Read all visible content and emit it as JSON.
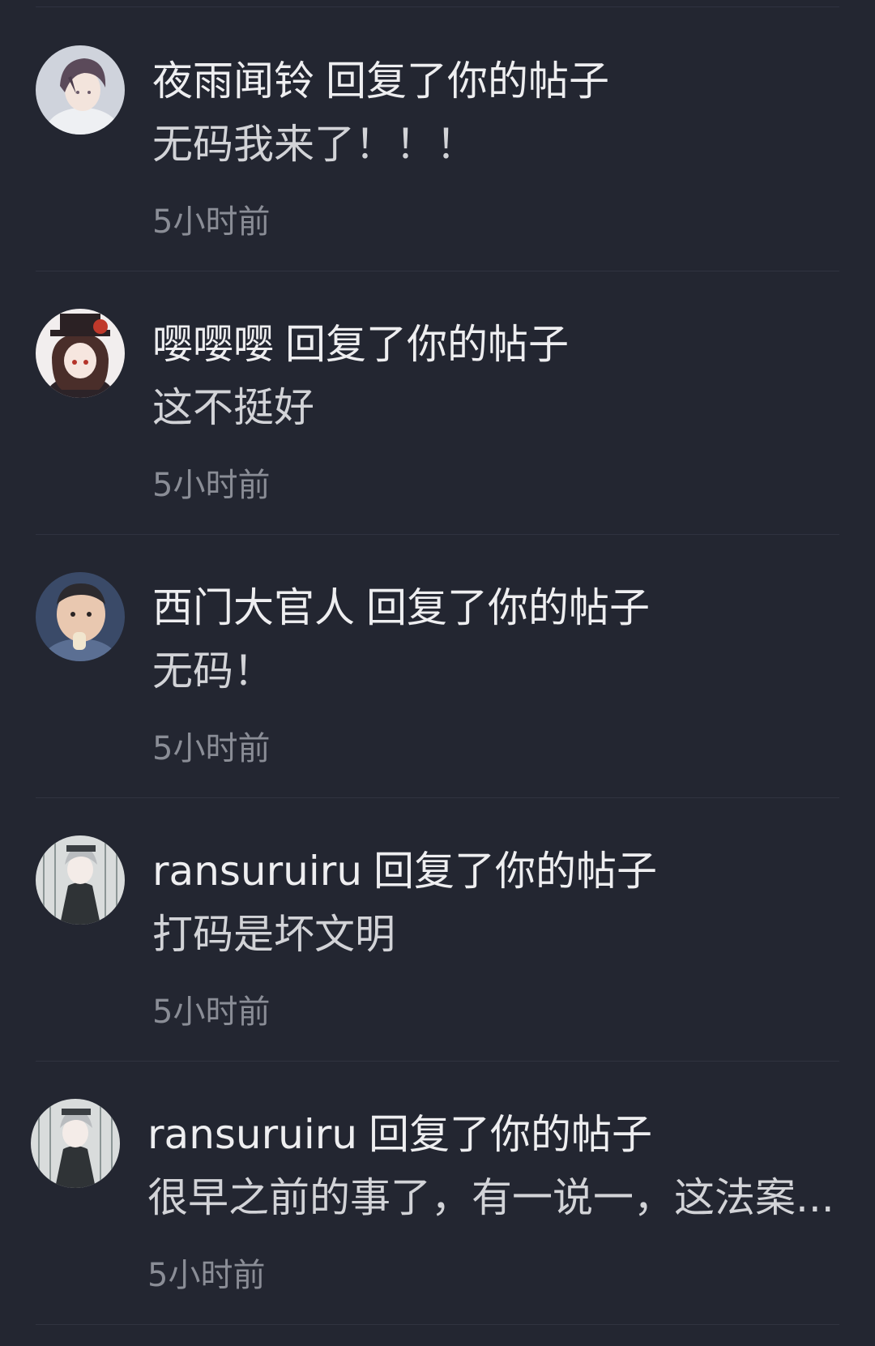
{
  "notifications": [
    {
      "username": "夜雨闻铃",
      "action": "回复了你的帖子",
      "content": "无码我来了！！！",
      "time": "5小时前",
      "avatar_icon": "anime-boy-avatar-icon"
    },
    {
      "username": "嘤嘤嘤",
      "action": "回复了你的帖子",
      "content": "这不挺好",
      "time": "5小时前",
      "avatar_icon": "anime-girl-hat-avatar-icon"
    },
    {
      "username": "西门大官人",
      "action": "回复了你的帖子",
      "content": "无码！",
      "time": "5小时前",
      "avatar_icon": "baby-photo-avatar-icon"
    },
    {
      "username": "ransuruiru",
      "action": "回复了你的帖子",
      "content": "打码是坏文明",
      "time": "5小时前",
      "avatar_icon": "anime-gothic-avatar-icon"
    },
    {
      "username": "ransuruiru",
      "action": "回复了你的帖子",
      "content": "很早之前的事了，有一说一，这法案...",
      "time": "5小时前",
      "avatar_icon": "anime-gothic-avatar-icon"
    }
  ],
  "colors": {
    "background": "#232631",
    "divider": "#303340",
    "primary_text": "#eeeef0",
    "secondary_text": "#8a8d96"
  }
}
